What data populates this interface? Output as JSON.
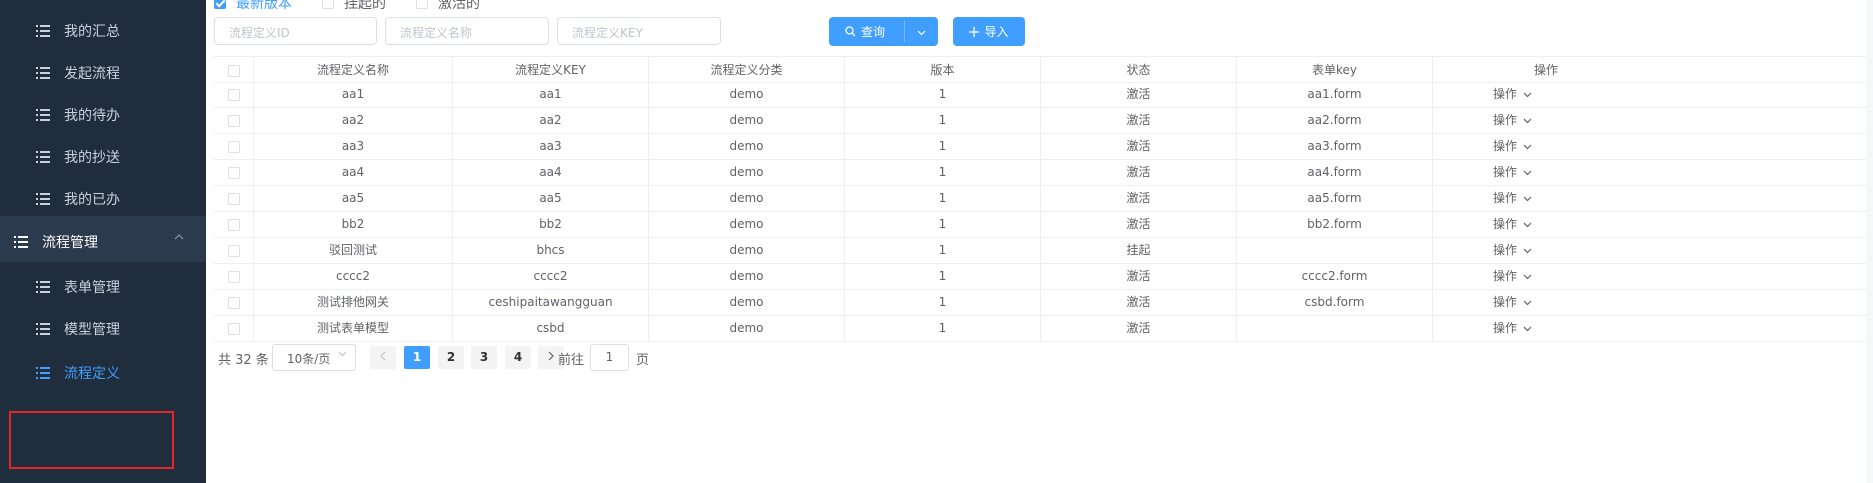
{
  "sidebar": {
    "items": [
      {
        "label": "我的汇总",
        "type": "child"
      },
      {
        "label": "发起流程",
        "type": "child"
      },
      {
        "label": "我的待办",
        "type": "child"
      },
      {
        "label": "我的抄送",
        "type": "child"
      },
      {
        "label": "我的已办",
        "type": "child"
      },
      {
        "label": "流程管理",
        "type": "group"
      },
      {
        "label": "表单管理",
        "type": "child"
      },
      {
        "label": "模型管理",
        "type": "child"
      },
      {
        "label": "流程定义",
        "type": "child",
        "active": true
      }
    ]
  },
  "filters": {
    "checkboxes": [
      {
        "label": "最新版本",
        "checked": true
      },
      {
        "label": "挂起的",
        "checked": false
      },
      {
        "label": "激活的",
        "checked": false
      }
    ],
    "inputs": [
      {
        "placeholder": "流程定义ID"
      },
      {
        "placeholder": "流程定义名称"
      },
      {
        "placeholder": "流程定义KEY"
      }
    ],
    "query_label": "查询",
    "import_label": "导入"
  },
  "table": {
    "headers": [
      "流程定义名称",
      "流程定义KEY",
      "流程定义分类",
      "版本",
      "状态",
      "表单key",
      "操作"
    ],
    "rows": [
      [
        "aa1",
        "aa1",
        "demo",
        "1",
        "激活",
        "aa1.form",
        "操作"
      ],
      [
        "aa2",
        "aa2",
        "demo",
        "1",
        "激活",
        "aa2.form",
        "操作"
      ],
      [
        "aa3",
        "aa3",
        "demo",
        "1",
        "激活",
        "aa3.form",
        "操作"
      ],
      [
        "aa4",
        "aa4",
        "demo",
        "1",
        "激活",
        "aa4.form",
        "操作"
      ],
      [
        "aa5",
        "aa5",
        "demo",
        "1",
        "激活",
        "aa5.form",
        "操作"
      ],
      [
        "bb2",
        "bb2",
        "demo",
        "1",
        "激活",
        "bb2.form",
        "操作"
      ],
      [
        "驳回测试",
        "bhcs",
        "demo",
        "1",
        "挂起",
        "",
        "操作"
      ],
      [
        "cccc2",
        "cccc2",
        "demo",
        "1",
        "激活",
        "cccc2.form",
        "操作"
      ],
      [
        "测试排他网关",
        "ceshipaitawangguan",
        "demo",
        "1",
        "激活",
        "csbd.form",
        "操作"
      ],
      [
        "测试表单模型",
        "csbd",
        "demo",
        "1",
        "激活",
        "",
        "操作"
      ]
    ]
  },
  "pagination": {
    "total_text": "共 32 条",
    "page_size": "10条/页",
    "pages": [
      "1",
      "2",
      "3",
      "4"
    ],
    "current_page": "1",
    "goto_label": "前往",
    "goto_value": "1",
    "page_unit": "页"
  },
  "colors": {
    "sidebar_bg": "#1f2d3d",
    "group_bg": "#2b3a4c",
    "accent": "#409eff",
    "highlight": "#e2262a"
  }
}
